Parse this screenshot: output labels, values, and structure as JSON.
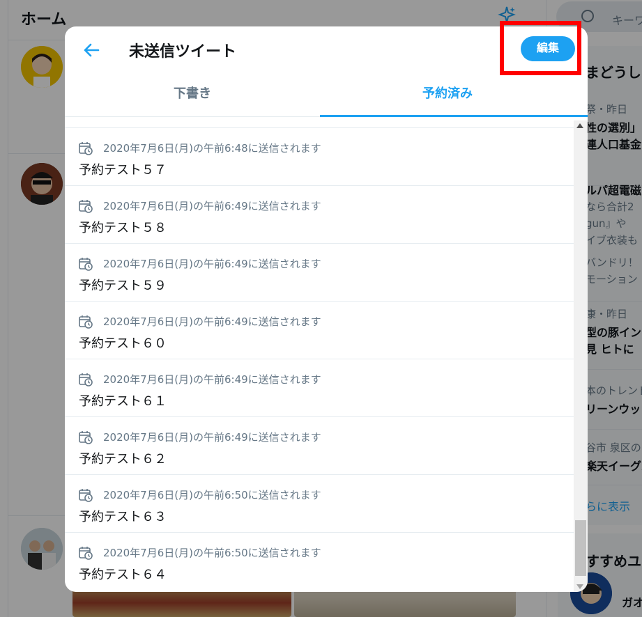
{
  "background": {
    "timeline_title": "ホーム",
    "search_placeholder": "キーワ",
    "trends": {
      "header": "まどうし",
      "items": [
        {
          "meta": "祭・昨日",
          "lines": [
            "性の選別」",
            "連人口基金"
          ]
        },
        {
          "meta": "",
          "lines": [
            "ルパ超電磁"
          ],
          "subs": [
            "なら合計2",
            "gun』や",
            "イブ衣装も",
            "バンドリ！",
            "モーション"
          ]
        },
        {
          "meta": "康・昨日",
          "lines": [
            "型の豚イン",
            "見 ヒトに"
          ]
        },
        {
          "meta": "本のトレンド",
          "lines": [
            "リーンウッ"
          ]
        },
        {
          "meta": "谷市 泉区の",
          "lines": [
            "楽天イーグル"
          ]
        }
      ],
      "show_more": "らに表示"
    },
    "follow_header": "すすめユ",
    "follow_name": "ガオ"
  },
  "modal": {
    "title": "未送信ツイート",
    "edit_label": "編集",
    "tabs": [
      {
        "label": "下書き",
        "active": false
      },
      {
        "label": "予約済み",
        "active": true
      }
    ],
    "scheduled_tweets": [
      {
        "schedule": "2020年7月6日(月)の午前6:48に送信されます",
        "text": "予約テスト５７"
      },
      {
        "schedule": "2020年7月6日(月)の午前6:49に送信されます",
        "text": "予約テスト５８"
      },
      {
        "schedule": "2020年7月6日(月)の午前6:49に送信されます",
        "text": "予約テスト５９"
      },
      {
        "schedule": "2020年7月6日(月)の午前6:49に送信されます",
        "text": "予約テスト６０"
      },
      {
        "schedule": "2020年7月6日(月)の午前6:49に送信されます",
        "text": "予約テスト６１"
      },
      {
        "schedule": "2020年7月6日(月)の午前6:49に送信されます",
        "text": "予約テスト６２"
      },
      {
        "schedule": "2020年7月6日(月)の午前6:50に送信されます",
        "text": "予約テスト６３"
      },
      {
        "schedule": "2020年7月6日(月)の午前6:50に送信されます",
        "text": "予約テスト６４"
      }
    ]
  },
  "colors": {
    "accent": "#1da1f2",
    "muted_text": "#657786",
    "highlight": "#ff0000"
  }
}
